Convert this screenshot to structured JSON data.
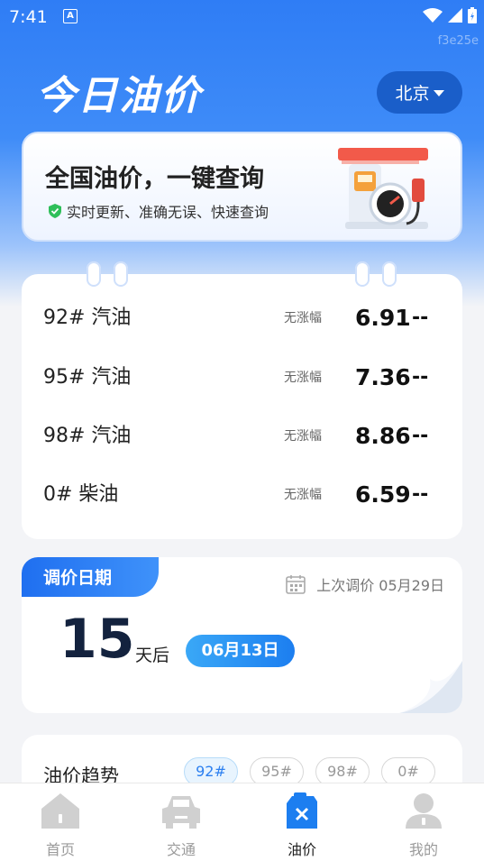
{
  "status_bar": {
    "time": "7:41",
    "app_badge": "A"
  },
  "watermark": "f3e25e",
  "header": {
    "title": "今日油价",
    "city": "北京"
  },
  "banner": {
    "title": "全国油价，一键查询",
    "subtitle": "实时更新、准确无误、快速查询"
  },
  "prices": [
    {
      "name": "92# 汽油",
      "trend": "无涨幅",
      "price": "6.91",
      "change": "--"
    },
    {
      "name": "95# 汽油",
      "trend": "无涨幅",
      "price": "7.36",
      "change": "--"
    },
    {
      "name": "98# 汽油",
      "trend": "无涨幅",
      "price": "8.86",
      "change": "--"
    },
    {
      "name": "0# 柴油",
      "trend": "无涨幅",
      "price": "6.59",
      "change": "--"
    }
  ],
  "adjust": {
    "tag": "调价日期",
    "last_adjust": "上次调价 05月29日",
    "days": "15",
    "unit": "天后",
    "next_date": "06月13日"
  },
  "trend": {
    "title": "油价趋势",
    "chips": [
      "92#",
      "95#",
      "98#",
      "0#"
    ],
    "active_chip": "92#"
  },
  "tabs": [
    {
      "label": "首页",
      "icon": "home-icon"
    },
    {
      "label": "交通",
      "icon": "car-icon"
    },
    {
      "label": "油价",
      "icon": "fuel-can-icon"
    },
    {
      "label": "我的",
      "icon": "user-icon"
    }
  ],
  "active_tab": "油价",
  "colors": {
    "primary": "#2f7df5",
    "dark_blue": "#1a5ec9",
    "accent_blue": "#1c7ef0",
    "tab_inactive": "#d0d0d0"
  }
}
